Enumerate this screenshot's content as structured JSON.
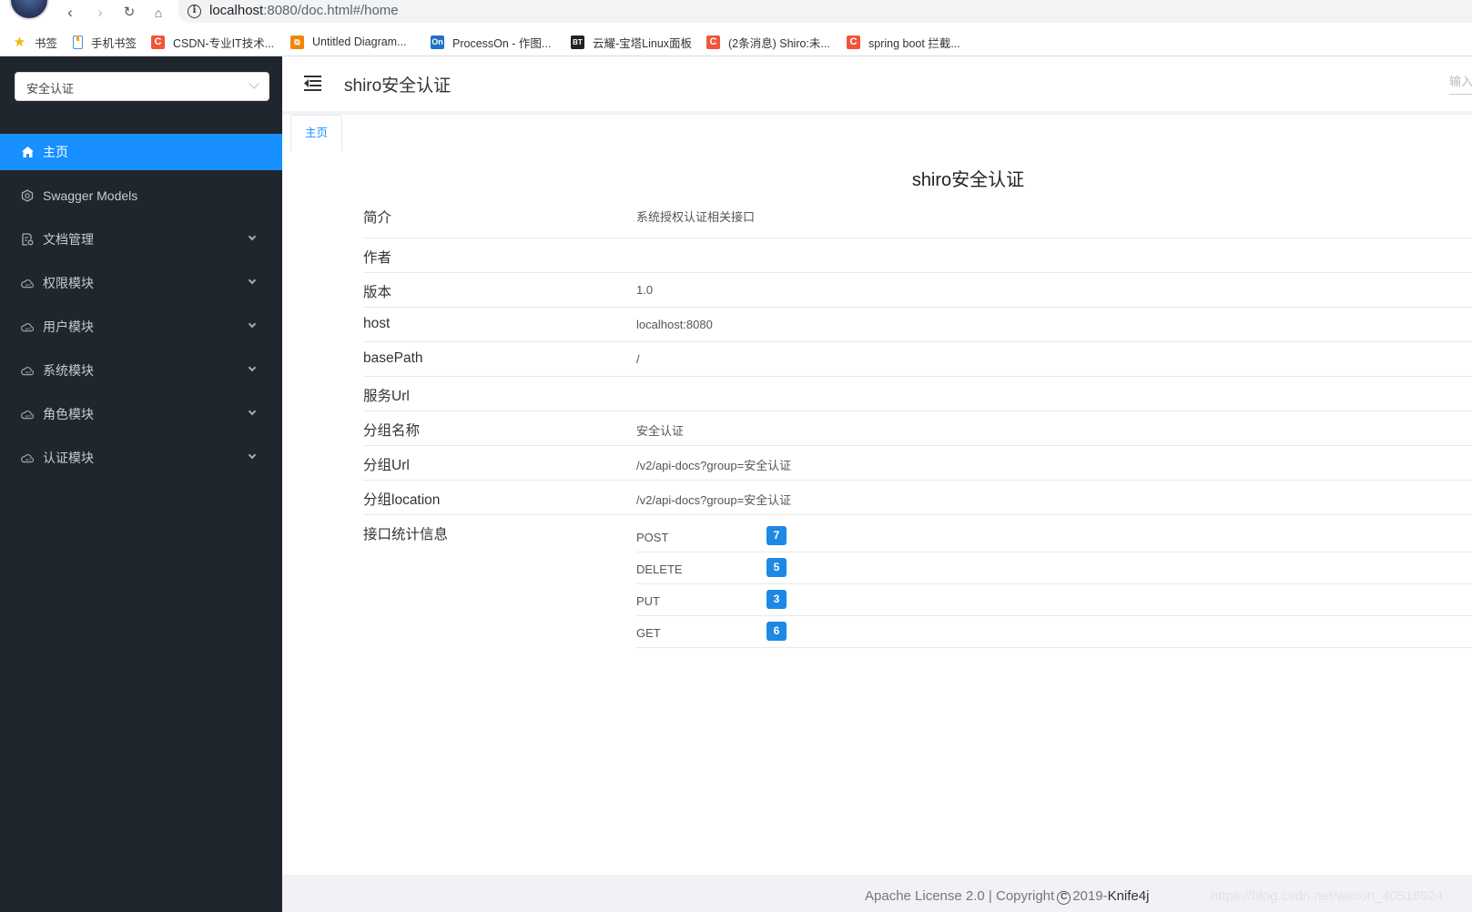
{
  "browser": {
    "url_host": "localhost",
    "url_rest": ":8080/doc.html#/home",
    "bookmarks": [
      {
        "label": "书签",
        "icon": "star-icon"
      },
      {
        "label": "手机书签",
        "icon": "mobile-bookmark-icon"
      },
      {
        "label": "CSDN-专业IT技术...",
        "icon": "csdn-icon",
        "glyph": "C"
      },
      {
        "label": "Untitled Diagram...",
        "icon": "drawio-icon",
        "glyph": "⧉"
      },
      {
        "label": "ProcessOn - 作图...",
        "icon": "processon-icon",
        "glyph": "On"
      },
      {
        "label": "云耀-宝塔Linux面板",
        "icon": "bt-panel-icon",
        "glyph": "BT"
      },
      {
        "label": "(2条消息) Shiro:未...",
        "icon": "csdn-icon",
        "glyph": "C"
      },
      {
        "label": "spring boot 拦截...",
        "icon": "csdn-icon",
        "glyph": "C"
      }
    ]
  },
  "sidebar": {
    "group_select": "安全认证",
    "items": [
      {
        "label": "主页",
        "icon": "home-icon",
        "active": true,
        "expandable": false
      },
      {
        "label": "Swagger Models",
        "icon": "models-icon",
        "active": false,
        "expandable": false
      },
      {
        "label": "文档管理",
        "icon": "document-settings-icon",
        "active": false,
        "expandable": true
      },
      {
        "label": "权限模块",
        "icon": "cloud-api-icon",
        "active": false,
        "expandable": true
      },
      {
        "label": "用户模块",
        "icon": "cloud-api-icon",
        "active": false,
        "expandable": true
      },
      {
        "label": "系统模块",
        "icon": "cloud-api-icon",
        "active": false,
        "expandable": true
      },
      {
        "label": "角色模块",
        "icon": "cloud-api-icon",
        "active": false,
        "expandable": true
      },
      {
        "label": "认证模块",
        "icon": "cloud-api-icon",
        "active": false,
        "expandable": true
      }
    ]
  },
  "header": {
    "title": "shiro安全认证",
    "search_placeholder": "输入"
  },
  "tabs": [
    {
      "label": "主页",
      "active": true
    }
  ],
  "doc": {
    "title": "shiro安全认证",
    "rows": [
      {
        "label": "简介",
        "value": "系统授权认证相关接口"
      },
      {
        "label": "作者",
        "value": ""
      },
      {
        "label": "版本",
        "value": "1.0"
      },
      {
        "label": "host",
        "value": "localhost:8080"
      },
      {
        "label": "basePath",
        "value": "/"
      },
      {
        "label": "服务Url",
        "value": ""
      },
      {
        "label": "分组名称",
        "value": "安全认证"
      },
      {
        "label": "分组Url",
        "value": "/v2/api-docs?group=安全认证"
      },
      {
        "label": "分组location",
        "value": "/v2/api-docs?group=安全认证"
      }
    ],
    "stats_label": "接口统计信息",
    "stats": [
      {
        "method": "POST",
        "count": "7"
      },
      {
        "method": "DELETE",
        "count": "5"
      },
      {
        "method": "PUT",
        "count": "3"
      },
      {
        "method": "GET",
        "count": "6"
      }
    ]
  },
  "footer": {
    "text_prefix": "Apache License 2.0 | Copyright",
    "copyright_symbol": "C",
    "year": "2019-",
    "brand": "Knife4j",
    "watermark": "https://blog.csdn.net/weixin_40516924"
  },
  "colors": {
    "accent": "#1890ff",
    "sidebar_bg": "#20262d",
    "badge": "#1e88e5"
  }
}
